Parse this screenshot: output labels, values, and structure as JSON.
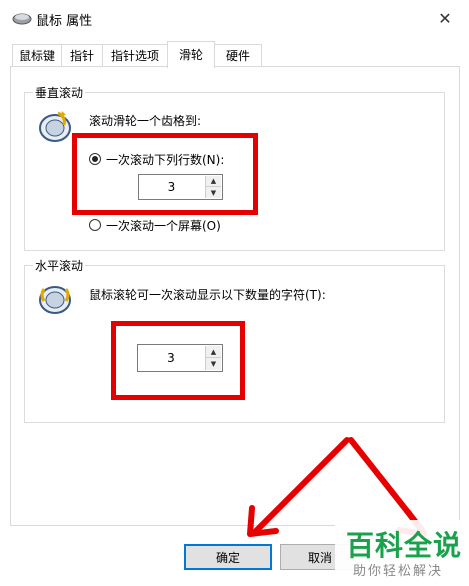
{
  "window": {
    "title": "鼠标 属性",
    "close_glyph": "✕"
  },
  "tabs": [
    {
      "label": "鼠标键",
      "active": false
    },
    {
      "label": "指针",
      "active": false
    },
    {
      "label": "指针选项",
      "active": false
    },
    {
      "label": "滑轮",
      "active": true
    },
    {
      "label": "硬件",
      "active": false
    }
  ],
  "vertical": {
    "title": "垂直滚动",
    "description": "滚动滑轮一个齿格到:",
    "option_lines": "一次滚动下列行数(N):",
    "option_lines_checked": true,
    "lines_value": "3",
    "option_screen": "一次滚动一个屏幕(O)",
    "option_screen_checked": false
  },
  "horizontal": {
    "title": "水平滚动",
    "description": "鼠标滚轮可一次滚动显示以下数量的字符(T):",
    "chars_value": "3"
  },
  "buttons": {
    "ok": "确定",
    "cancel": "取消"
  },
  "spin_glyphs": {
    "up": "▲",
    "down": "▼"
  },
  "watermark": {
    "main": "百科全说",
    "sub": "助你轻松解决"
  },
  "colors": {
    "highlight": "#e60000",
    "accent": "#0078d7",
    "watermark_green": "#1aa14c"
  },
  "icons": [
    "mouse-icon",
    "close-icon",
    "wheel-icon",
    "spin-up-icon",
    "spin-down-icon",
    "arrow-icon"
  ]
}
